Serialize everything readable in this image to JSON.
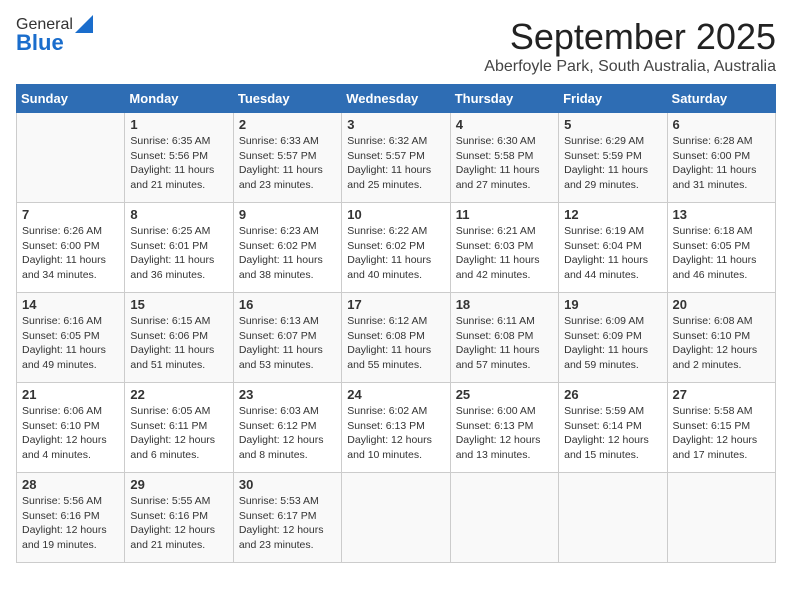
{
  "header": {
    "logo_general": "General",
    "logo_blue": "Blue",
    "month": "September 2025",
    "location": "Aberfoyle Park, South Australia, Australia"
  },
  "days_of_week": [
    "Sunday",
    "Monday",
    "Tuesday",
    "Wednesday",
    "Thursday",
    "Friday",
    "Saturday"
  ],
  "weeks": [
    [
      {
        "day": "",
        "sunrise": "",
        "sunset": "",
        "daylight": ""
      },
      {
        "day": "1",
        "sunrise": "Sunrise: 6:35 AM",
        "sunset": "Sunset: 5:56 PM",
        "daylight": "Daylight: 11 hours and 21 minutes."
      },
      {
        "day": "2",
        "sunrise": "Sunrise: 6:33 AM",
        "sunset": "Sunset: 5:57 PM",
        "daylight": "Daylight: 11 hours and 23 minutes."
      },
      {
        "day": "3",
        "sunrise": "Sunrise: 6:32 AM",
        "sunset": "Sunset: 5:57 PM",
        "daylight": "Daylight: 11 hours and 25 minutes."
      },
      {
        "day": "4",
        "sunrise": "Sunrise: 6:30 AM",
        "sunset": "Sunset: 5:58 PM",
        "daylight": "Daylight: 11 hours and 27 minutes."
      },
      {
        "day": "5",
        "sunrise": "Sunrise: 6:29 AM",
        "sunset": "Sunset: 5:59 PM",
        "daylight": "Daylight: 11 hours and 29 minutes."
      },
      {
        "day": "6",
        "sunrise": "Sunrise: 6:28 AM",
        "sunset": "Sunset: 6:00 PM",
        "daylight": "Daylight: 11 hours and 31 minutes."
      }
    ],
    [
      {
        "day": "7",
        "sunrise": "Sunrise: 6:26 AM",
        "sunset": "Sunset: 6:00 PM",
        "daylight": "Daylight: 11 hours and 34 minutes."
      },
      {
        "day": "8",
        "sunrise": "Sunrise: 6:25 AM",
        "sunset": "Sunset: 6:01 PM",
        "daylight": "Daylight: 11 hours and 36 minutes."
      },
      {
        "day": "9",
        "sunrise": "Sunrise: 6:23 AM",
        "sunset": "Sunset: 6:02 PM",
        "daylight": "Daylight: 11 hours and 38 minutes."
      },
      {
        "day": "10",
        "sunrise": "Sunrise: 6:22 AM",
        "sunset": "Sunset: 6:02 PM",
        "daylight": "Daylight: 11 hours and 40 minutes."
      },
      {
        "day": "11",
        "sunrise": "Sunrise: 6:21 AM",
        "sunset": "Sunset: 6:03 PM",
        "daylight": "Daylight: 11 hours and 42 minutes."
      },
      {
        "day": "12",
        "sunrise": "Sunrise: 6:19 AM",
        "sunset": "Sunset: 6:04 PM",
        "daylight": "Daylight: 11 hours and 44 minutes."
      },
      {
        "day": "13",
        "sunrise": "Sunrise: 6:18 AM",
        "sunset": "Sunset: 6:05 PM",
        "daylight": "Daylight: 11 hours and 46 minutes."
      }
    ],
    [
      {
        "day": "14",
        "sunrise": "Sunrise: 6:16 AM",
        "sunset": "Sunset: 6:05 PM",
        "daylight": "Daylight: 11 hours and 49 minutes."
      },
      {
        "day": "15",
        "sunrise": "Sunrise: 6:15 AM",
        "sunset": "Sunset: 6:06 PM",
        "daylight": "Daylight: 11 hours and 51 minutes."
      },
      {
        "day": "16",
        "sunrise": "Sunrise: 6:13 AM",
        "sunset": "Sunset: 6:07 PM",
        "daylight": "Daylight: 11 hours and 53 minutes."
      },
      {
        "day": "17",
        "sunrise": "Sunrise: 6:12 AM",
        "sunset": "Sunset: 6:08 PM",
        "daylight": "Daylight: 11 hours and 55 minutes."
      },
      {
        "day": "18",
        "sunrise": "Sunrise: 6:11 AM",
        "sunset": "Sunset: 6:08 PM",
        "daylight": "Daylight: 11 hours and 57 minutes."
      },
      {
        "day": "19",
        "sunrise": "Sunrise: 6:09 AM",
        "sunset": "Sunset: 6:09 PM",
        "daylight": "Daylight: 11 hours and 59 minutes."
      },
      {
        "day": "20",
        "sunrise": "Sunrise: 6:08 AM",
        "sunset": "Sunset: 6:10 PM",
        "daylight": "Daylight: 12 hours and 2 minutes."
      }
    ],
    [
      {
        "day": "21",
        "sunrise": "Sunrise: 6:06 AM",
        "sunset": "Sunset: 6:10 PM",
        "daylight": "Daylight: 12 hours and 4 minutes."
      },
      {
        "day": "22",
        "sunrise": "Sunrise: 6:05 AM",
        "sunset": "Sunset: 6:11 PM",
        "daylight": "Daylight: 12 hours and 6 minutes."
      },
      {
        "day": "23",
        "sunrise": "Sunrise: 6:03 AM",
        "sunset": "Sunset: 6:12 PM",
        "daylight": "Daylight: 12 hours and 8 minutes."
      },
      {
        "day": "24",
        "sunrise": "Sunrise: 6:02 AM",
        "sunset": "Sunset: 6:13 PM",
        "daylight": "Daylight: 12 hours and 10 minutes."
      },
      {
        "day": "25",
        "sunrise": "Sunrise: 6:00 AM",
        "sunset": "Sunset: 6:13 PM",
        "daylight": "Daylight: 12 hours and 13 minutes."
      },
      {
        "day": "26",
        "sunrise": "Sunrise: 5:59 AM",
        "sunset": "Sunset: 6:14 PM",
        "daylight": "Daylight: 12 hours and 15 minutes."
      },
      {
        "day": "27",
        "sunrise": "Sunrise: 5:58 AM",
        "sunset": "Sunset: 6:15 PM",
        "daylight": "Daylight: 12 hours and 17 minutes."
      }
    ],
    [
      {
        "day": "28",
        "sunrise": "Sunrise: 5:56 AM",
        "sunset": "Sunset: 6:16 PM",
        "daylight": "Daylight: 12 hours and 19 minutes."
      },
      {
        "day": "29",
        "sunrise": "Sunrise: 5:55 AM",
        "sunset": "Sunset: 6:16 PM",
        "daylight": "Daylight: 12 hours and 21 minutes."
      },
      {
        "day": "30",
        "sunrise": "Sunrise: 5:53 AM",
        "sunset": "Sunset: 6:17 PM",
        "daylight": "Daylight: 12 hours and 23 minutes."
      },
      {
        "day": "",
        "sunrise": "",
        "sunset": "",
        "daylight": ""
      },
      {
        "day": "",
        "sunrise": "",
        "sunset": "",
        "daylight": ""
      },
      {
        "day": "",
        "sunrise": "",
        "sunset": "",
        "daylight": ""
      },
      {
        "day": "",
        "sunrise": "",
        "sunset": "",
        "daylight": ""
      }
    ]
  ]
}
